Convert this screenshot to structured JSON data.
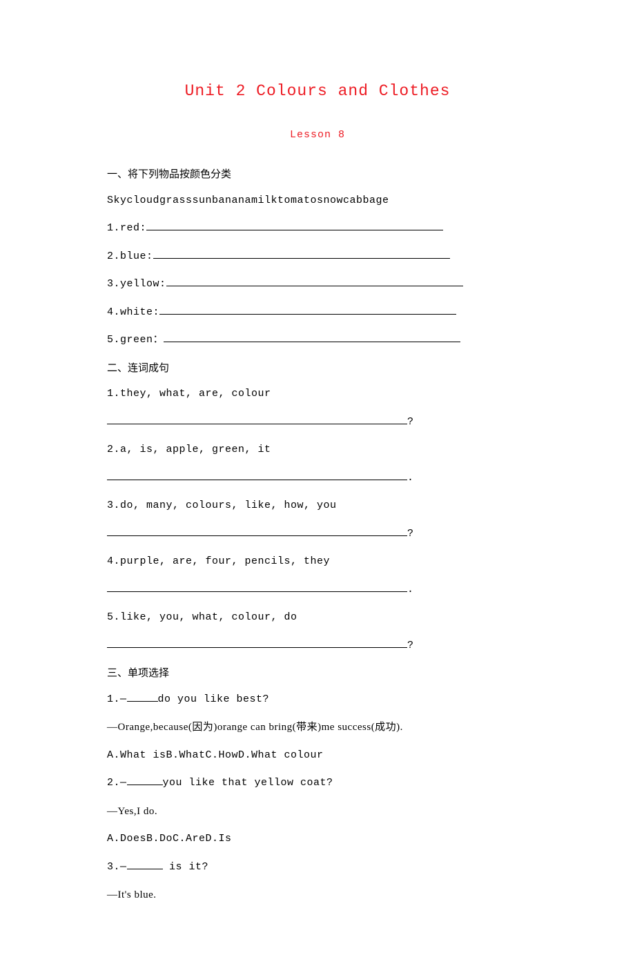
{
  "title": "Unit 2 Colours and Clothes",
  "subtitle": "Lesson 8",
  "sections": {
    "s1": {
      "heading": "一、将下列物品按颜色分类",
      "word_list": "Skycloudgrasssunbananamilktomatosnowcabbage",
      "items": [
        {
          "prefix": "1.red:"
        },
        {
          "prefix": "2.blue:"
        },
        {
          "prefix": "3.yellow:"
        },
        {
          "prefix": "4.white:"
        },
        {
          "prefix": "5.green："
        }
      ]
    },
    "s2": {
      "heading": "二、连词成句",
      "items": [
        {
          "words": "1.they, what, are, colour",
          "end": "?"
        },
        {
          "words": "2.a, is, apple, green, it",
          "end": "."
        },
        {
          "words": "3.do, many, colours, like, how, you",
          "end": "?"
        },
        {
          "words": "4.purple, are, four, pencils, they",
          "end": "."
        },
        {
          "words": "5.like, you, what, colour, do",
          "end": "?"
        }
      ]
    },
    "s3": {
      "heading": "三、单项选择",
      "q1": {
        "prompt_pre": "1.—",
        "prompt_post": "do you like best?",
        "answer_pre": "—Orange,because(因为)orange can bring(带来)me success(成功).",
        "options": "A.What isB.WhatC.HowD.What colour"
      },
      "q2": {
        "prompt_pre": "2.—",
        "prompt_post": "you like that yellow coat?",
        "answer": "—Yes,I do.",
        "options": "A.DoesB.DoC.AreD.Is"
      },
      "q3": {
        "prompt_pre": "3.—",
        "prompt_post": " is it?",
        "answer": "—It's blue."
      }
    }
  }
}
